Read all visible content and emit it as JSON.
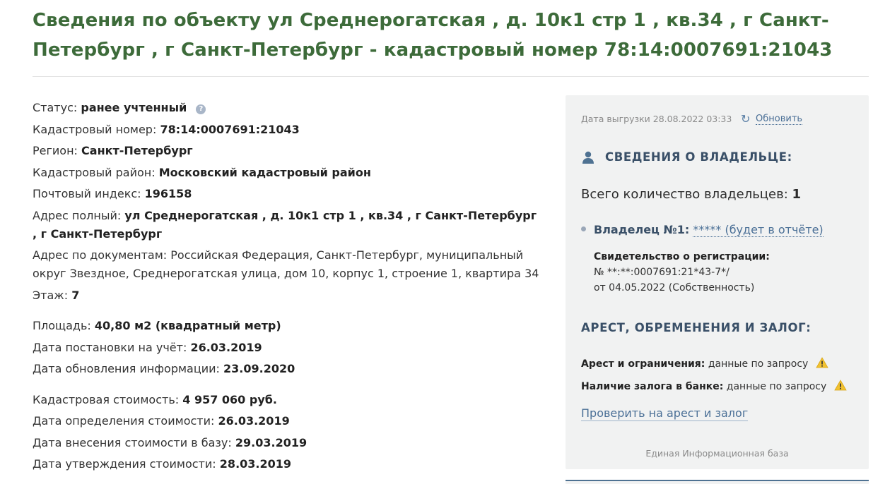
{
  "header": {
    "title": "Сведения по объекту ул Среднерогатская , д. 10к1 стр 1 , кв.34 , г Санкт-Петербург , г Санкт-Петербург - кадастровый номер 78:14:0007691:21043"
  },
  "details": {
    "status": {
      "label": "Статус:",
      "value": "ранее учтенный"
    },
    "cadastral_number": {
      "label": "Кадастровый номер:",
      "value": "78:14:0007691:21043"
    },
    "region": {
      "label": "Регион:",
      "value": "Санкт-Петербург"
    },
    "district": {
      "label": "Кадастровый район:",
      "value": "Московский кадастровый район"
    },
    "postal_code": {
      "label": "Почтовый индекс:",
      "value": "196158"
    },
    "address_full": {
      "label": "Адрес полный:",
      "value": "ул Среднерогатская , д. 10к1 стр 1 , кв.34 , г Санкт-Петербург , г Санкт-Петербург"
    },
    "address_docs": {
      "label": "Адрес по документам:",
      "value": "Российская Федерация, Санкт-Петербург, муниципальный округ Звездное, Среднерогатская улица, дом 10, корпус 1, строение 1, квартира 34"
    },
    "floor": {
      "label": "Этаж:",
      "value": "7"
    },
    "area": {
      "label": "Площадь:",
      "value": "40,80 м2 (квадратный метр)"
    },
    "registered": {
      "label": "Дата постановки на учёт:",
      "value": "26.03.2019"
    },
    "updated": {
      "label": "Дата обновления информации:",
      "value": "23.09.2020"
    },
    "cost": {
      "label": "Кадастровая стоимость:",
      "value": "4 957 060 руб."
    },
    "cost_determined": {
      "label": "Дата определения стоимости:",
      "value": "26.03.2019"
    },
    "cost_entered": {
      "label": "Дата внесения стоимости в базу:",
      "value": "29.03.2019"
    },
    "cost_approved": {
      "label": "Дата утверждения стоимости:",
      "value": "28.03.2019"
    }
  },
  "sidebar": {
    "export_date": "Дата выгрузки 28.08.2022 03:33",
    "refresh_label": "Обновить",
    "owner_section_title": "СВЕДЕНИЯ О ВЛАДЕЛЬЦЕ:",
    "owners_count_label": "Всего количество владельцев:",
    "owners_count": "1",
    "owner_label": "Владелец №1:",
    "owner_link": "***** (будет в отчёте)",
    "cert_label": "Свидетельство о регистрации:",
    "cert_number": "№ **:**:0007691:21*43-7*/",
    "cert_date": "от 04.05.2022 (Собственность)",
    "arrest_section_title": "АРЕСТ, ОБРЕМЕНЕНИЯ И ЗАЛОГ:",
    "arrest_label": "Арест и ограничения:",
    "arrest_value": "данные по запросу",
    "pledge_label": "Наличие залога в банке:",
    "pledge_value": "данные по запросу",
    "check_link": "Проверить на арест и залог",
    "footer": "Единая Информационная база"
  },
  "colors": {
    "title_green": "#3d6b3a",
    "link_blue": "#4a6f96",
    "section_heading": "#3a5068",
    "panel_bg": "#f1f2f2",
    "warning_yellow": "#f2c230"
  },
  "icons": {
    "status_help": "question-circle-icon",
    "refresh": "refresh-icon",
    "owner": "user-icon",
    "warning": "warning-icon"
  }
}
